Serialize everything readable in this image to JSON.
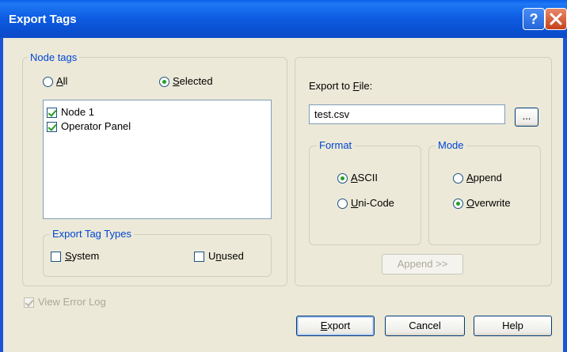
{
  "window": {
    "title": "Export Tags",
    "help_glyph": "?",
    "close_glyph": "✕"
  },
  "node_tags": {
    "legend": "Node tags",
    "all_label": "All",
    "selected_label": "Selected",
    "selected_option": "Selected",
    "items": [
      {
        "label": "Node 1",
        "checked": true
      },
      {
        "label": "Operator Panel",
        "checked": true
      }
    ]
  },
  "export_tag_types": {
    "legend": "Export Tag Types",
    "system_label": "System",
    "system_checked": false,
    "unused_label": "Unused",
    "unused_checked": false
  },
  "export_file": {
    "label": "Export to File:",
    "value": "test.csv",
    "browse_label": "..."
  },
  "format": {
    "legend": "Format",
    "ascii_label": "ASCII",
    "unicode_label": "Uni-Code",
    "selected": "ASCII"
  },
  "mode": {
    "legend": "Mode",
    "append_label": "Append",
    "overwrite_label": "Overwrite",
    "selected": "Overwrite"
  },
  "append_button": "Append >>",
  "view_error_log": {
    "label": "View Error Log",
    "checked": true,
    "enabled": false
  },
  "buttons": {
    "export": "Export",
    "cancel": "Cancel",
    "help": "Help"
  },
  "colors": {
    "title_bar": "#0a4fd1",
    "group_legend": "#0046d5",
    "dialog_bg": "#ece9d8",
    "radio_dot": "#21a121"
  }
}
